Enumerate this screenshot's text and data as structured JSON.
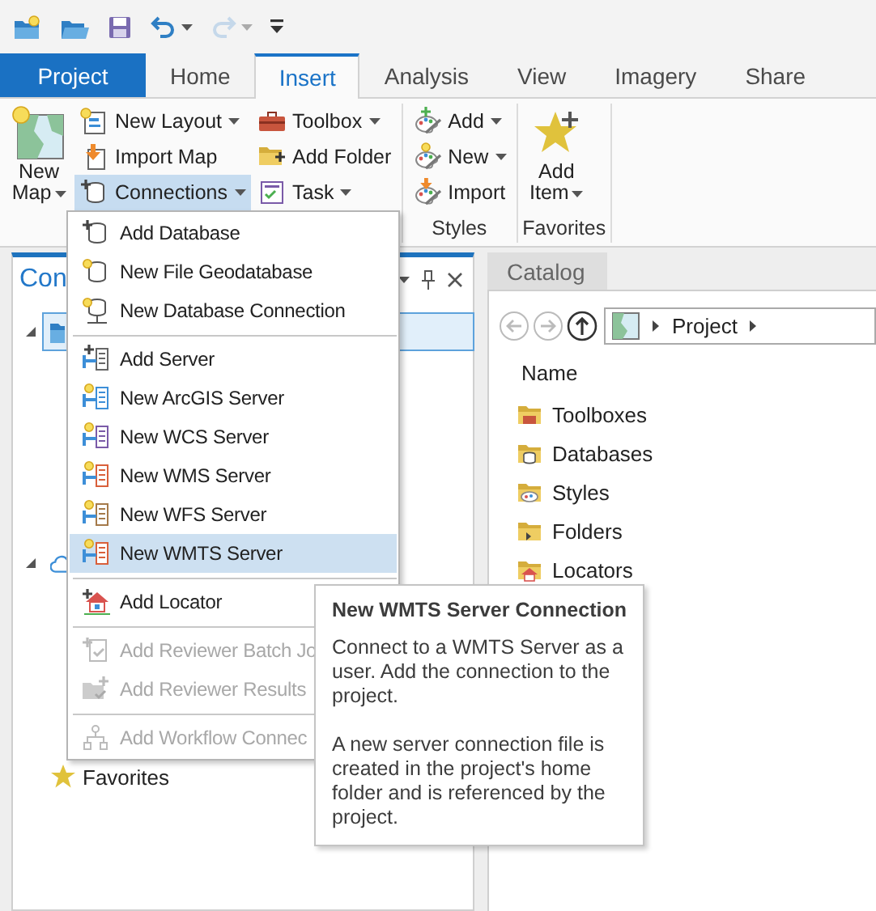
{
  "quick_access": [
    {
      "kind": "new",
      "disabled": false,
      "dropdown": false
    },
    {
      "kind": "open",
      "disabled": false,
      "dropdown": false
    },
    {
      "kind": "save",
      "disabled": false,
      "dropdown": false
    },
    {
      "kind": "undo",
      "disabled": false,
      "dropdown": true
    },
    {
      "kind": "redo",
      "disabled": true,
      "dropdown": true
    },
    {
      "kind": "customize",
      "disabled": false,
      "dropdown": false
    }
  ],
  "tabs": [
    {
      "label": "Project",
      "kind": "backstage",
      "selected": false
    },
    {
      "label": "Home",
      "kind": "tab",
      "selected": false
    },
    {
      "label": "Insert",
      "kind": "tab",
      "selected": true
    },
    {
      "label": "Analysis",
      "kind": "tab",
      "selected": false
    },
    {
      "label": "View",
      "kind": "tab",
      "selected": false
    },
    {
      "label": "Imagery",
      "kind": "tab",
      "selected": false
    },
    {
      "label": "Share",
      "kind": "tab",
      "selected": false
    }
  ],
  "ribbon": {
    "groups": [
      {
        "buttons": [
          {
            "label": "New Map",
            "kind": "large",
            "dropdown": true,
            "pressed": false
          },
          {
            "label": "New Layout",
            "kind": "small",
            "dropdown": true,
            "pressed": false
          },
          {
            "label": "Import Map",
            "kind": "small",
            "dropdown": false,
            "pressed": false
          },
          {
            "label": "Connections",
            "kind": "small",
            "dropdown": true,
            "pressed": true
          },
          {
            "label": "Toolbox",
            "kind": "small",
            "dropdown": true,
            "pressed": false
          },
          {
            "label": "Add Folder",
            "kind": "small",
            "dropdown": false,
            "pressed": false
          },
          {
            "label": "Task",
            "kind": "small",
            "dropdown": true,
            "pressed": false
          }
        ]
      },
      {
        "label": "Styles",
        "buttons": [
          {
            "label": "Add",
            "kind": "small",
            "dropdown": true,
            "pressed": false
          },
          {
            "label": "New",
            "kind": "small",
            "dropdown": true,
            "pressed": false
          },
          {
            "label": "Import",
            "kind": "small",
            "dropdown": false,
            "pressed": false
          }
        ]
      },
      {
        "label": "Favorites",
        "buttons": [
          {
            "label": "Add Item",
            "kind": "large",
            "dropdown": true,
            "pressed": false
          }
        ]
      }
    ]
  },
  "contents_pane": {
    "title": "Con",
    "tree": [
      {
        "kind": "project",
        "expanded": true,
        "selected": true
      },
      {
        "kind": "portal",
        "expanded": true,
        "selected": false
      },
      {
        "kind": "favorites",
        "label": "Favorites",
        "selected": false
      }
    ]
  },
  "catalog_pane": {
    "tab": {
      "label": "Catalog"
    },
    "nav": [
      {
        "kind": "back",
        "disabled": true
      },
      {
        "kind": "forward",
        "disabled": true
      },
      {
        "kind": "up",
        "disabled": false
      }
    ],
    "path": [
      "Project"
    ],
    "column": "Name",
    "items": [
      {
        "label": "Toolboxes"
      },
      {
        "label": "Databases"
      },
      {
        "label": "Styles"
      },
      {
        "label": "Folders"
      },
      {
        "label": "Locators"
      }
    ]
  },
  "menu": {
    "sections": [
      [
        {
          "label": "Add Database",
          "disabled": false,
          "selected": false
        },
        {
          "label": "New File Geodatabase",
          "disabled": false,
          "selected": false
        },
        {
          "label": "New Database Connection",
          "disabled": false,
          "selected": false
        }
      ],
      [
        {
          "label": "Add Server",
          "disabled": false,
          "selected": false
        },
        {
          "label": "New ArcGIS Server",
          "disabled": false,
          "selected": false
        },
        {
          "label": "New WCS Server",
          "disabled": false,
          "selected": false
        },
        {
          "label": "New WMS Server",
          "disabled": false,
          "selected": false
        },
        {
          "label": "New WFS Server",
          "disabled": false,
          "selected": false
        },
        {
          "label": "New WMTS Server",
          "disabled": false,
          "selected": true
        }
      ],
      [
        {
          "label": "Add Locator",
          "disabled": false,
          "selected": false
        }
      ],
      [
        {
          "label": "Add Reviewer Batch Jo",
          "disabled": true,
          "selected": false
        },
        {
          "label": "Add Reviewer Results",
          "disabled": true,
          "selected": false
        }
      ],
      [
        {
          "label": "Add Workflow Connec",
          "disabled": true,
          "selected": false
        }
      ]
    ]
  },
  "tooltip": {
    "title": "New WMTS Server Connection",
    "paragraphs": [
      "Connect to a WMTS Server as a user. Add the connection to the project.",
      "A new server connection file is created in the project's home folder and is referenced by the project."
    ]
  }
}
